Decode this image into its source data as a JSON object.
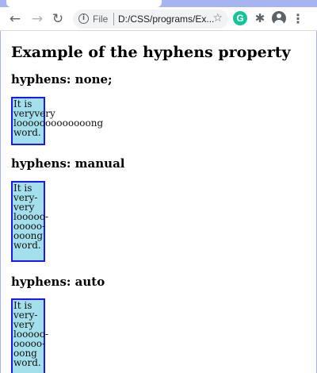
{
  "browser": {
    "omnibox": {
      "protocol_label": "File",
      "url": "D:/CSS/programs/Ex..."
    },
    "icons": {
      "back": "back-arrow-icon",
      "forward": "forward-arrow-icon",
      "reload": "reload-icon",
      "info": "info-icon",
      "bookmark": "star-icon",
      "extension_grammarly": "grammarly-icon",
      "extension_puzzle": "puzzle-icon",
      "profile": "profile-icon",
      "menu": "kebab-menu-icon"
    },
    "colors": {
      "frame": "#a7b4f2",
      "toolbar": "#ffffff",
      "omnibox": "#f1f3f4",
      "grammarly": "#15c39a"
    }
  },
  "page": {
    "title": "Example of the hyphens property",
    "sections": [
      {
        "heading": "hyphens: none;",
        "lines": [
          "It is",
          "veryvery",
          "looooooooooooong",
          "word."
        ]
      },
      {
        "heading": "hyphens: manual",
        "lines": [
          "It is",
          "very-",
          "very",
          "looooo-",
          "ooooo-",
          "ooong",
          "word."
        ]
      },
      {
        "heading": "hyphens: auto",
        "lines": [
          "It is",
          "very-",
          "very",
          "looooo-",
          "ooooo-",
          "oong",
          "word."
        ]
      }
    ],
    "colors": {
      "box_background": "#a4dfec",
      "box_border": "#1a1af0"
    }
  }
}
